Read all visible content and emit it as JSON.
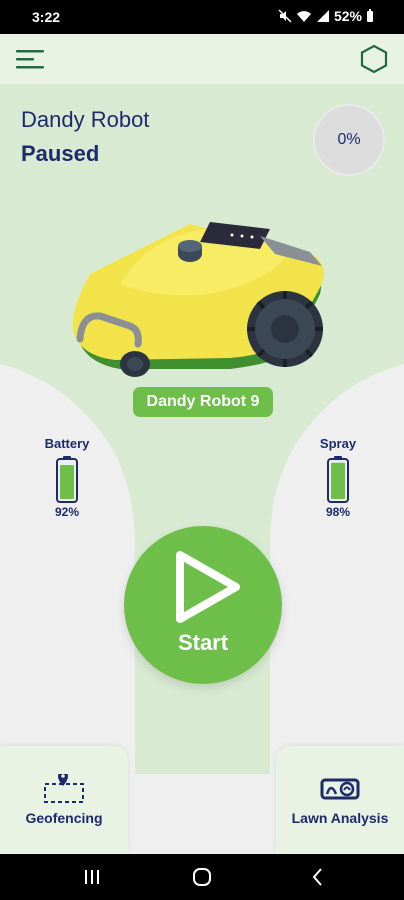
{
  "status_bar": {
    "time": "3:22",
    "battery": "52%"
  },
  "header": {
    "menu_icon": "menu-icon",
    "brand_icon": "hexagon-icon"
  },
  "robot": {
    "name": "Dandy Robot",
    "status": "Paused",
    "progress": "0%",
    "label": "Dandy Robot 9"
  },
  "gauges": {
    "battery": {
      "label": "Battery",
      "value": "92%",
      "level": 0.92
    },
    "spray": {
      "label": "Spray",
      "value": "98%",
      "level": 0.98
    }
  },
  "start_button": {
    "label": "Start"
  },
  "bottom_cards": {
    "geofencing": {
      "label": "Geofencing"
    },
    "lawn_analysis": {
      "label": "Lawn Analysis"
    }
  },
  "colors": {
    "accent": "#6ebe4a",
    "text": "#1d2a6b",
    "header_bg": "#e8f3e3"
  }
}
